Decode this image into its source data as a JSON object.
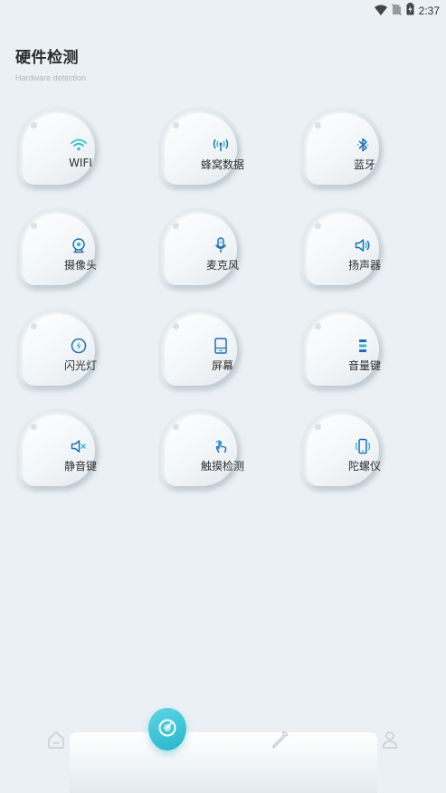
{
  "status_bar": {
    "time": "2:37",
    "icons": [
      "wifi-icon",
      "no-sim-icon",
      "battery-charging-icon"
    ]
  },
  "header": {
    "title": "硬件检测",
    "subtitle": "Hardware detection"
  },
  "tiles": [
    {
      "label": "WIFI",
      "icon": "wifi-icon"
    },
    {
      "label": "蜂窝数据",
      "icon": "cellular-icon"
    },
    {
      "label": "蓝牙",
      "icon": "bluetooth-icon"
    },
    {
      "label": "摄像头",
      "icon": "camera-icon"
    },
    {
      "label": "麦克风",
      "icon": "microphone-icon"
    },
    {
      "label": "扬声器",
      "icon": "speaker-icon"
    },
    {
      "label": "闪光灯",
      "icon": "flash-icon"
    },
    {
      "label": "屏幕",
      "icon": "screen-icon"
    },
    {
      "label": "音量键",
      "icon": "volume-keys-icon"
    },
    {
      "label": "静音键",
      "icon": "mute-icon"
    },
    {
      "label": "触摸检测",
      "icon": "touch-icon"
    },
    {
      "label": "陀螺仪",
      "icon": "gyroscope-icon"
    }
  ],
  "bottom_nav": {
    "items": [
      "home-icon",
      "scan-icon",
      "tools-icon",
      "profile-icon"
    ],
    "active": "scan-icon"
  },
  "colors": {
    "accent": "#2fbdd2",
    "background": "#eaf0f4",
    "icon_blue": "#1f6fb6"
  }
}
